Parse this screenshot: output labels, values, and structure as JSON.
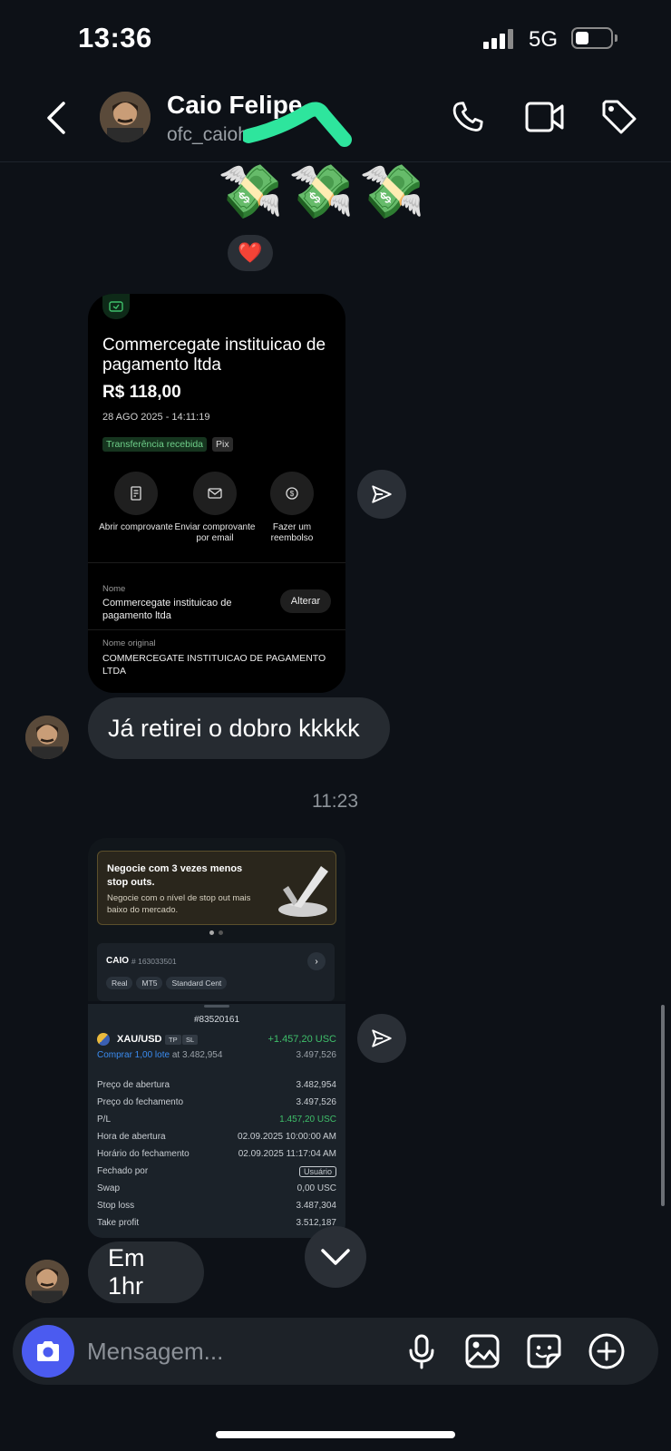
{
  "status_bar": {
    "time": "13:36",
    "network": "5G"
  },
  "header": {
    "contact_name": "Caio Felipe",
    "username": "ofc_caioh",
    "icons": [
      "back-icon",
      "phone-icon",
      "video-icon",
      "tag-icon"
    ]
  },
  "messages": {
    "money_emojis": "💸💸💸",
    "reaction": "❤️",
    "payment_card": {
      "title": "Commercegate instituicao de pagamento ltda",
      "amount": "R$ 118,00",
      "datetime": "28 AGO 2025 - 14:11:19",
      "badge_status": "Transferência recebida",
      "badge_method": "Pix",
      "actions": [
        "Abrir comprovante",
        "Enviar comprovante por email",
        "Fazer um reembolso"
      ],
      "name_label": "Nome",
      "name_value": "Commercegate instituicao de pagamento ltda",
      "edit_button": "Alterar",
      "original_name_label": "Nome original",
      "original_name_value": "COMMERCEGATE INSTITUICAO DE PAGAMENTO LTDA"
    },
    "text_1": "Já retirei o dobro kkkkk",
    "timestamp": "11:23",
    "trading_card": {
      "promo_title": "Negocie com 3 vezes menos stop outs.",
      "promo_body": "Negocie com o nível de stop out mais baixo do mercado.",
      "account_name": "CAIO",
      "account_number": "# 163033501",
      "account_tags": [
        "Real",
        "MT5",
        "Standard Cent"
      ],
      "order_id": "#83520161",
      "symbol": "XAU/USD",
      "symbol_tags": [
        "TP",
        "SL"
      ],
      "profit": "+1.457,20 USC",
      "order_desc": "Comprar 1,00 lote",
      "order_at": "at 3.482,954",
      "current_price": "3.497,526",
      "details": [
        {
          "label": "Preço de abertura",
          "value": "3.482,954"
        },
        {
          "label": "Preço do fechamento",
          "value": "3.497,526"
        },
        {
          "label": "P/L",
          "value": "1.457,20 USC"
        },
        {
          "label": "Hora de abertura",
          "value": "02.09.2025 10:00:00 AM"
        },
        {
          "label": "Horário do fechamento",
          "value": "02.09.2025 11:17:04 AM"
        },
        {
          "label": "Fechado por",
          "value": "Usuário"
        },
        {
          "label": "Swap",
          "value": "0,00 USC"
        },
        {
          "label": "Stop loss",
          "value": "3.487,304"
        },
        {
          "label": "Take profit",
          "value": "3.512,187"
        }
      ]
    },
    "text_2": "Em 1hr"
  },
  "composer": {
    "placeholder": "Mensagem..."
  },
  "colors": {
    "accent": "#4b5bf0",
    "bubble": "#262b31",
    "profit": "#3fbf6a",
    "link": "#3b8cf0",
    "scribble": "#2ee59d"
  }
}
